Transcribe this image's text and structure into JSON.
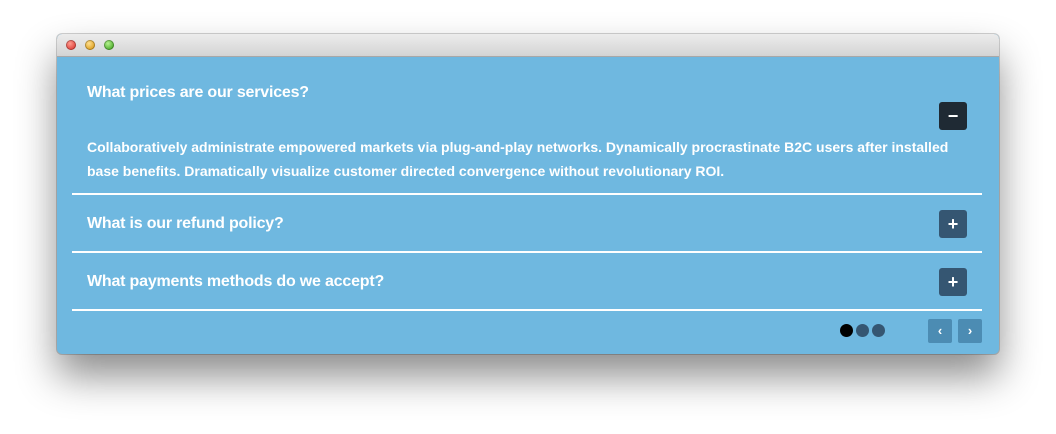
{
  "window": {
    "controls": [
      "close",
      "minimize",
      "maximize"
    ]
  },
  "faq": {
    "items": [
      {
        "question": "What prices are our services?",
        "answer": "Collaboratively administrate empowered markets via plug-and-play networks. Dynamically procrastinate B2C users after installed base benefits. Dramatically visualize customer directed convergence without revolutionary ROI.",
        "toggle": "−",
        "expanded": true
      },
      {
        "question": "What is our refund policy?",
        "toggle": "+",
        "expanded": false
      },
      {
        "question": "What payments methods do we accept?",
        "toggle": "+",
        "expanded": false
      }
    ]
  },
  "pagination": {
    "pages": 3,
    "current": 1,
    "prev_label": "‹",
    "next_label": "›"
  },
  "colors": {
    "panel_background": "#6fb8e0",
    "expanded_toggle": "#1f2a34",
    "collapsed_toggle": "#355672",
    "nav_button": "#4c8cb3",
    "active_dot": "#000000",
    "inactive_dot": "#355672"
  }
}
